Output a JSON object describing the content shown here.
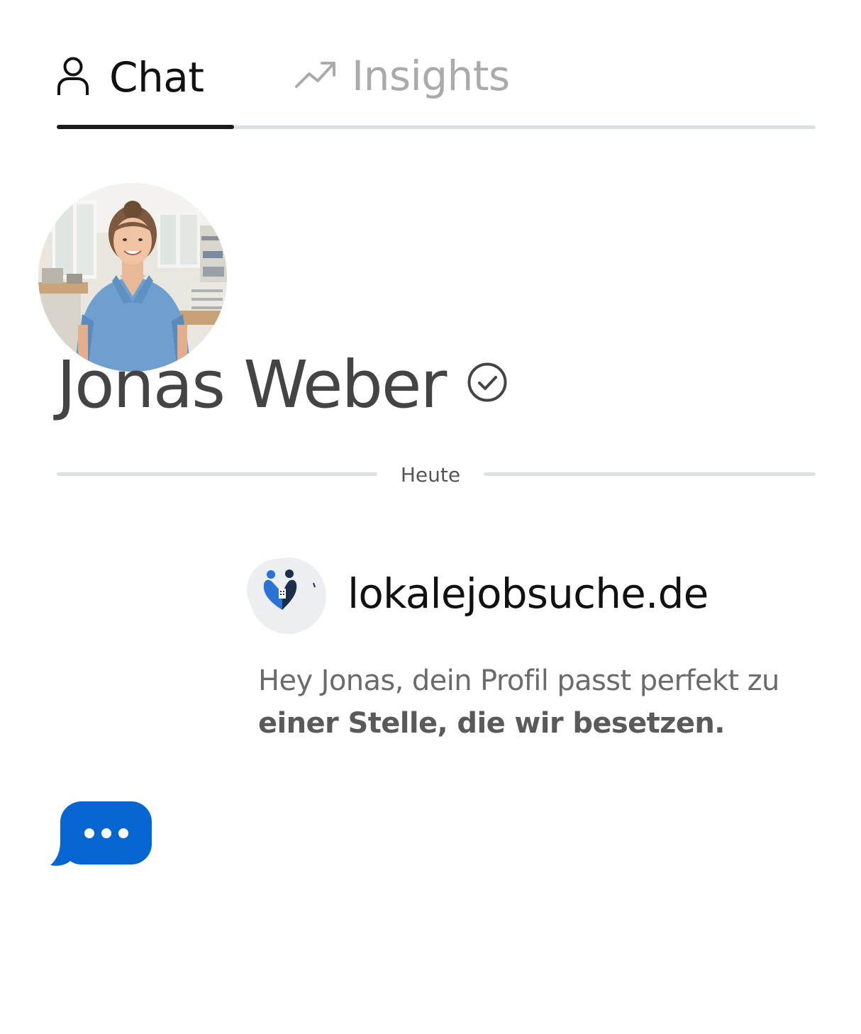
{
  "tabs": [
    {
      "label": "Chat",
      "icon": "person-icon",
      "active": true
    },
    {
      "label": "Insights",
      "icon": "trending-up-icon",
      "active": false
    }
  ],
  "profile": {
    "name": "Jonas Weber",
    "verified_icon": "verified-check-icon"
  },
  "conversation": {
    "date_divider": "Heute",
    "message": {
      "sender": "lokalejobsuche.de",
      "sender_logo": "lokalejobsuche-logo",
      "text_part1": "Hey Jonas, dein Profil passt perfekt zu ",
      "text_part2": "einer Stelle, die wir besetzen."
    },
    "typing_indicator": "typing-bubble-icon"
  },
  "colors": {
    "active_text": "#111111",
    "inactive_text": "#a9aaac",
    "track": "#dde0e4",
    "indicator": "#1b1b1b",
    "name_text": "#444444",
    "accent_blue": "#0566d1"
  }
}
